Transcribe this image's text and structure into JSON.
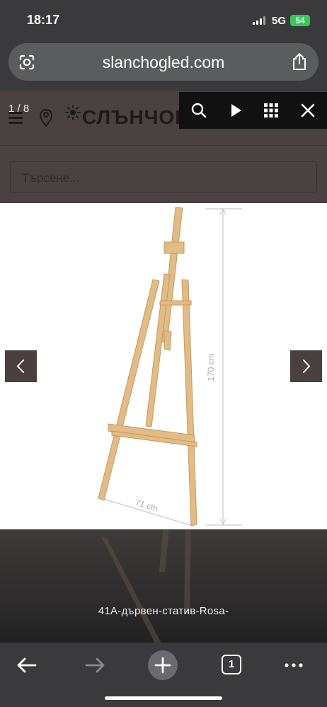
{
  "status_bar": {
    "time": "18:17",
    "network": "5G",
    "battery": "54"
  },
  "browser": {
    "url": "slanchogled.com",
    "tab_count": "1"
  },
  "site": {
    "logo": "СЛЪНЧОГЛЕД",
    "language": "BG",
    "search_placeholder": "Търсене..."
  },
  "lightbox": {
    "counter": "1 / 8",
    "caption": "41А-дървен-статив-Rosa-",
    "image": {
      "height_label": "170 cm",
      "width_label": "71 cm"
    }
  },
  "icons": {
    "toolbar": [
      "search-icon",
      "play-icon",
      "grid-icon",
      "close-icon"
    ],
    "bottom": [
      "back-arrow-icon",
      "forward-arrow-icon",
      "new-tab-icon",
      "tabs-icon",
      "more-icon"
    ]
  },
  "colors": {
    "battery": "#34c759",
    "overlay": "#4a4242",
    "toolbar": "#111111"
  }
}
